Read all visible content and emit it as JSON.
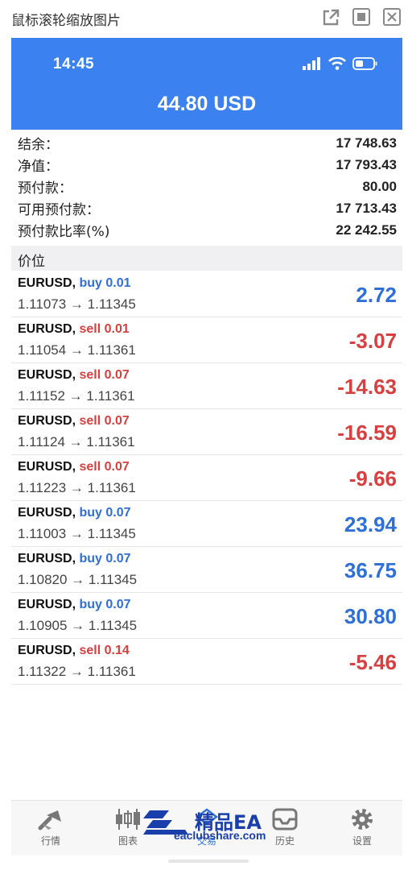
{
  "viewer": {
    "title": "鼠标滚轮缩放图片",
    "buttons": [
      "external-link-icon",
      "fit-screen-icon",
      "close-icon"
    ]
  },
  "status_bar": {
    "time": "14:45",
    "icons": [
      "signal-icon",
      "wifi-icon",
      "battery-icon"
    ]
  },
  "header": {
    "total_profit": "44.80 USD"
  },
  "summary": [
    {
      "label": "结余：",
      "value": "17 748.63"
    },
    {
      "label": "净值：",
      "value": "17 793.43"
    },
    {
      "label": "预付款：",
      "value": "80.00"
    },
    {
      "label": "可用预付款：",
      "value": "17 713.43"
    },
    {
      "label": "预付款比率(%)",
      "value": "22 242.55"
    }
  ],
  "positions_section_title": "价位",
  "positions": [
    {
      "symbol": "EURUSD,",
      "side": "buy 0.01",
      "direction": "buy",
      "prices": "1.11073 → 1.11345",
      "profit": "2.72"
    },
    {
      "symbol": "EURUSD,",
      "side": "sell 0.01",
      "direction": "sell",
      "prices": "1.11054 → 1.11361",
      "profit": "-3.07"
    },
    {
      "symbol": "EURUSD,",
      "side": "sell 0.07",
      "direction": "sell",
      "prices": "1.11152 → 1.11361",
      "profit": "-14.63"
    },
    {
      "symbol": "EURUSD,",
      "side": "sell 0.07",
      "direction": "sell",
      "prices": "1.11124 → 1.11361",
      "profit": "-16.59"
    },
    {
      "symbol": "EURUSD,",
      "side": "sell 0.07",
      "direction": "sell",
      "prices": "1.11223 → 1.11361",
      "profit": "-9.66"
    },
    {
      "symbol": "EURUSD,",
      "side": "buy 0.07",
      "direction": "buy",
      "prices": "1.11003 → 1.11345",
      "profit": "23.94"
    },
    {
      "symbol": "EURUSD,",
      "side": "buy 0.07",
      "direction": "buy",
      "prices": "1.10820 → 1.11345",
      "profit": "36.75"
    },
    {
      "symbol": "EURUSD,",
      "side": "buy 0.07",
      "direction": "buy",
      "prices": "1.10905 → 1.11345",
      "profit": "30.80"
    },
    {
      "symbol": "EURUSD,",
      "side": "sell 0.14",
      "direction": "sell",
      "prices": "1.11322 → 1.11361",
      "profit": "-5.46"
    }
  ],
  "bottom_nav": [
    {
      "label": "行情",
      "icon": "quotes-icon"
    },
    {
      "label": "图表",
      "icon": "chart-icon"
    },
    {
      "label": "交易",
      "icon": "trade-icon",
      "active": true
    },
    {
      "label": "历史",
      "icon": "history-icon"
    },
    {
      "label": "设置",
      "icon": "settings-icon"
    }
  ],
  "watermark": {
    "title": "精品EA",
    "subtitle": "eaclubshare.com"
  },
  "colors": {
    "header_blue": "#3b82f0",
    "buy_blue": "#2e6fd8",
    "sell_red": "#d64040"
  }
}
